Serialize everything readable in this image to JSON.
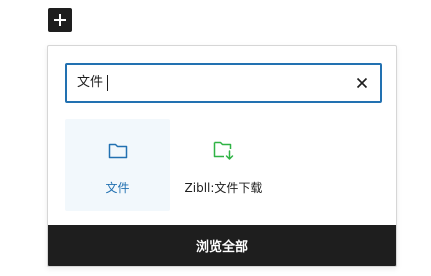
{
  "toolbar": {
    "add_block_icon": "plus-icon"
  },
  "search": {
    "value": "文件",
    "clear_icon": "close-icon"
  },
  "results": [
    {
      "label": "文件",
      "icon": "folder-icon",
      "selected": true,
      "color": "#2271b1"
    },
    {
      "label": "Zibll:文件下载",
      "icon": "folder-download-icon",
      "selected": false,
      "color": "#2fb344"
    }
  ],
  "footer": {
    "browse_all_label": "浏览全部"
  },
  "colors": {
    "accent": "#2271b1",
    "selected_bg": "#f2f8fc",
    "footer_bg": "#1e1e1e",
    "download_icon": "#2fb344"
  }
}
